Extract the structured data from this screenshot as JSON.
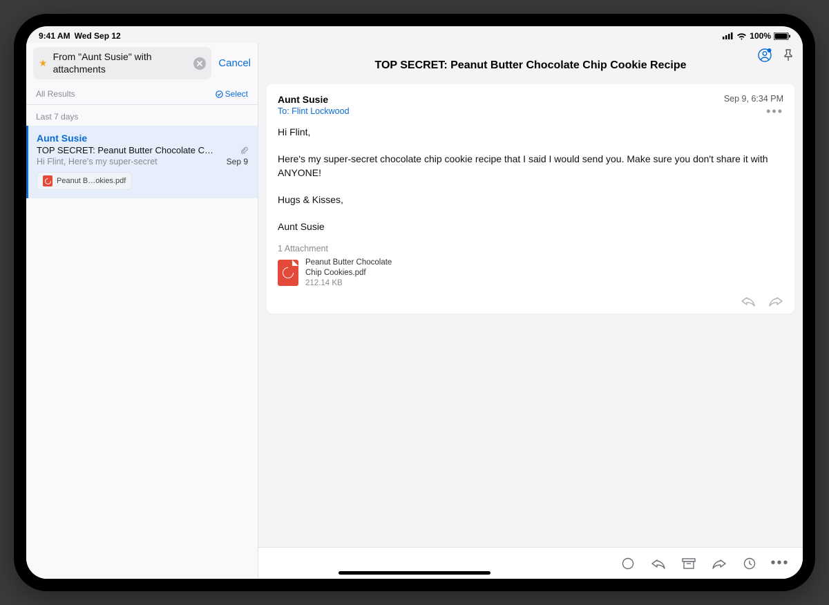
{
  "status": {
    "time": "9:41 AM",
    "date": "Wed Sep 12",
    "battery": "100%"
  },
  "sidebar": {
    "search_label": "From \"Aunt Susie\" with attachments",
    "cancel_label": "Cancel",
    "all_results_label": "All Results",
    "select_label": "Select",
    "section_label": "Last 7 days",
    "item": {
      "from": "Aunt Susie",
      "subject": "TOP SECRET: Peanut Butter Chocolate C…",
      "preview": "Hi Flint, Here's my super-secret",
      "date": "Sep 9",
      "attachment_chip": "Peanut B…okies.pdf"
    }
  },
  "main": {
    "title": "TOP SECRET: Peanut Butter Chocolate Chip Cookie Recipe",
    "from": "Aunt Susie",
    "to": "To: Flint Lockwood",
    "date": "Sep 9, 6:34 PM",
    "body": "Hi Flint,\n\nHere's my super-secret chocolate chip cookie recipe that I said I would send you. Make sure you don't share it with ANYONE!\n\nHugs & Kisses,\n\nAunt Susie",
    "attach_count": "1 Attachment",
    "attach_name": "Peanut Butter Chocolate Chip Cookies.pdf",
    "attach_size": "212.14 KB"
  }
}
